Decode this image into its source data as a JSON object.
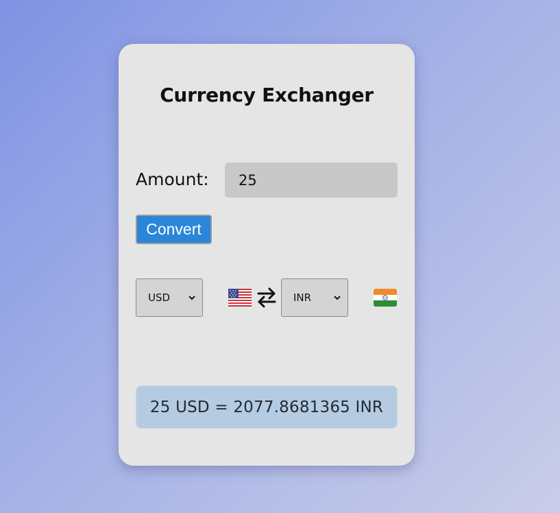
{
  "app": {
    "title": "Currency Exchanger"
  },
  "form": {
    "amount_label": "Amount:",
    "amount_value": "25",
    "convert_label": "Convert"
  },
  "currency": {
    "from": "USD",
    "to": "INR",
    "from_flag": "us-flag-icon",
    "to_flag": "india-flag-icon",
    "swap_icon": "swap-arrows-icon"
  },
  "result": {
    "text": "25 USD = 2077.8681365 INR"
  },
  "colors": {
    "accent": "#2b86d9",
    "card_background": "#e5e5e5",
    "result_background": "#b5cbe2"
  }
}
